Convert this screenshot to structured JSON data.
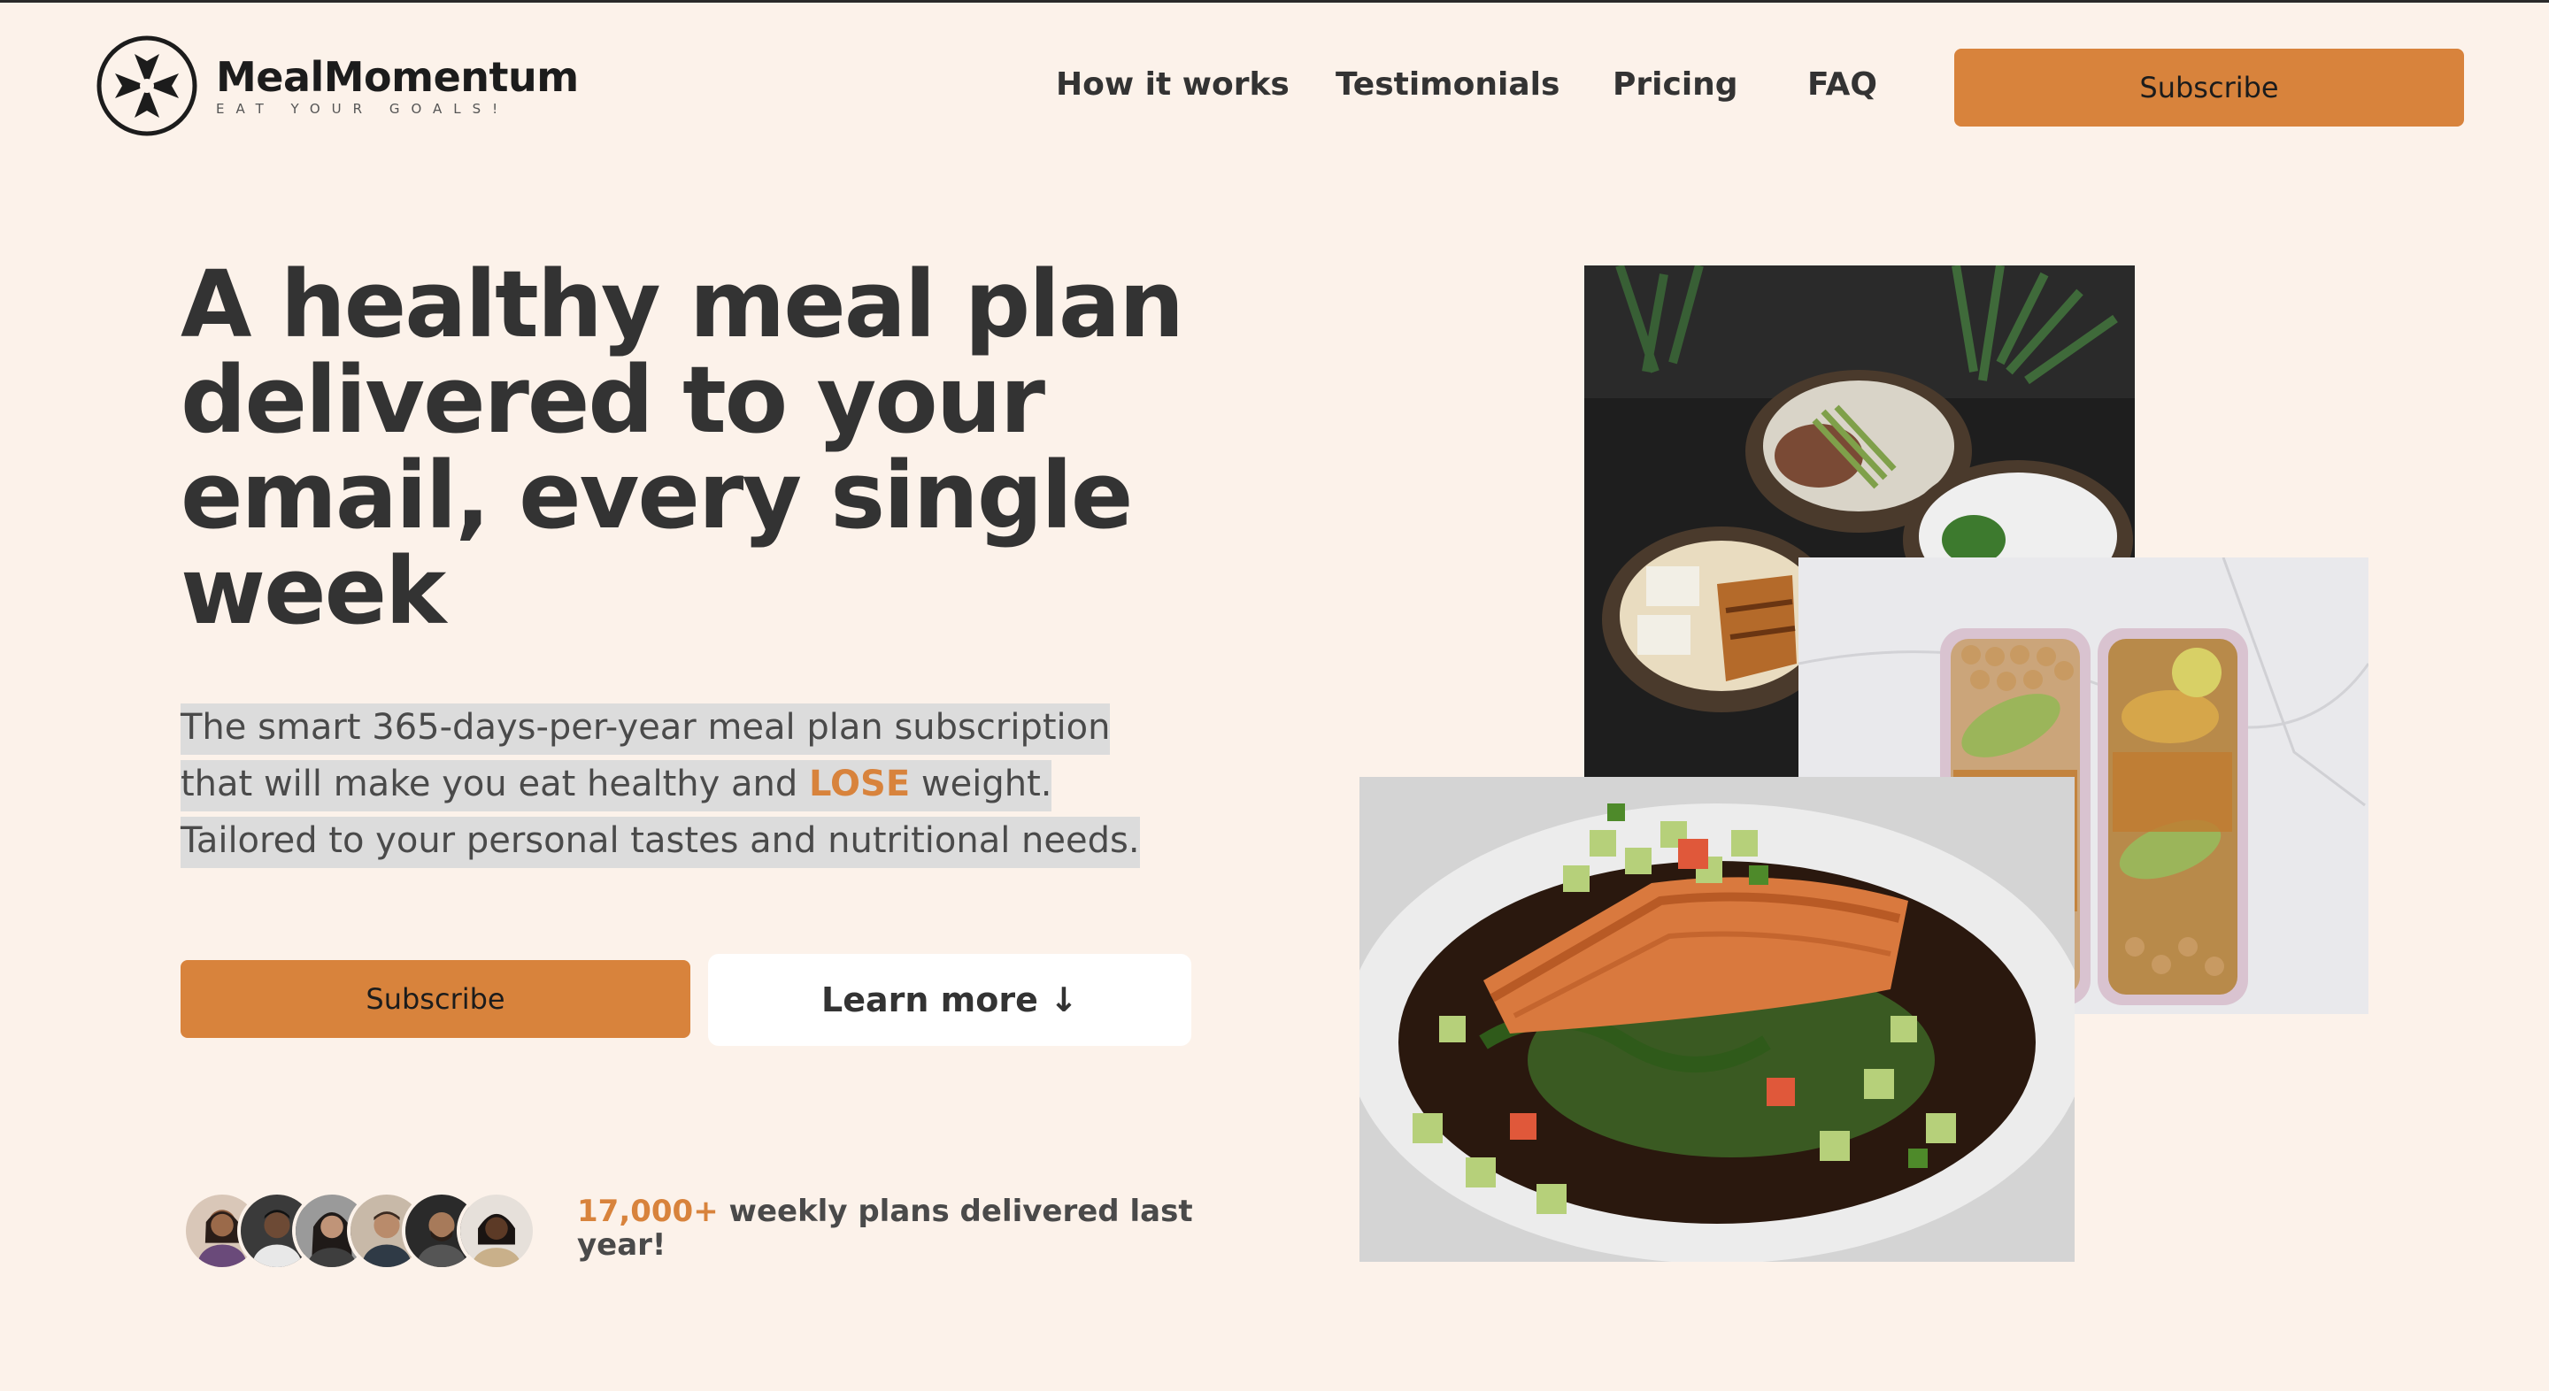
{
  "brand": {
    "name": "MealMomentum",
    "tagline": "EAT YOUR GOALS!"
  },
  "nav": {
    "items": [
      "How it works",
      "Testimonials",
      "Pricing",
      "FAQ"
    ],
    "cta": "Subscribe"
  },
  "hero": {
    "title": "A healthy meal plan delivered to your email, every single week",
    "description_before": "The smart 365-days-per-year meal plan subscription that will make you eat healthy and ",
    "description_highlight": "LOSE",
    "description_after": " weight. Tailored to your personal tastes and nutritional needs.",
    "primary_cta": "Subscribe",
    "secondary_cta": "Learn more ↓"
  },
  "social_proof": {
    "count": "17,000+",
    "text": " weekly plans delivered last year!"
  },
  "colors": {
    "accent": "#d8833c",
    "background": "#fcf2ea",
    "text": "#333333"
  },
  "icons": {
    "logo": "meal-momentum-logo-icon"
  }
}
